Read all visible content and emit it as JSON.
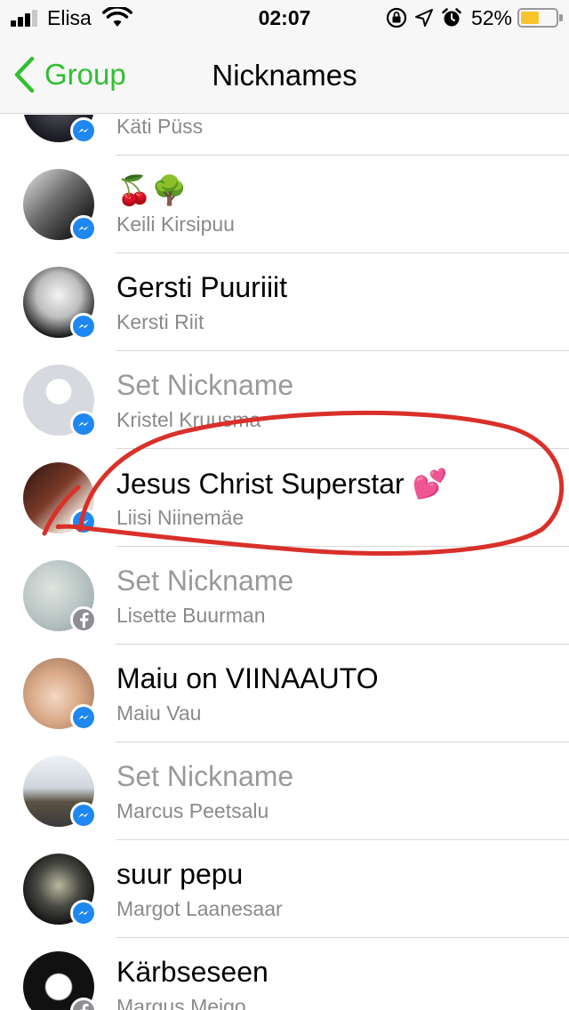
{
  "status_bar": {
    "carrier": "Elisa",
    "time": "02:07",
    "battery_percent": "52%",
    "battery_level": 0.52,
    "battery_color": "#f7c52b",
    "icons": [
      "signal-icon",
      "wifi-icon",
      "orientation-lock-icon",
      "location-arrow-icon",
      "alarm-icon",
      "battery-icon"
    ]
  },
  "nav": {
    "back_label": "Group",
    "title": "Nicknames",
    "accent_color": "#30c030"
  },
  "rows": [
    {
      "nickname": "",
      "name": "Käti Püss",
      "is_placeholder": false,
      "badge": "messenger"
    },
    {
      "nickname": "🍒🌳",
      "name": "Keili Kirsipuu",
      "is_placeholder": false,
      "badge": "messenger"
    },
    {
      "nickname": "Gersti  Puuriiit",
      "name": "Kersti Riit",
      "is_placeholder": false,
      "badge": "messenger"
    },
    {
      "nickname": "Set Nickname",
      "name": "Kristel Kruusma",
      "is_placeholder": true,
      "badge": "messenger"
    },
    {
      "nickname": "Jesus Christ Superstar 💕",
      "name": "Liisi Niinemäe",
      "is_placeholder": false,
      "badge": "messenger"
    },
    {
      "nickname": "Set Nickname",
      "name": "Lisette Buurman",
      "is_placeholder": true,
      "badge": "facebook"
    },
    {
      "nickname": "Maiu on VIINAAUTO",
      "name": "Maiu Vau",
      "is_placeholder": false,
      "badge": "messenger"
    },
    {
      "nickname": "Set Nickname",
      "name": "Marcus Peetsalu",
      "is_placeholder": true,
      "badge": "messenger"
    },
    {
      "nickname": "suur pepu",
      "name": "Margot Laanesaar",
      "is_placeholder": false,
      "badge": "messenger"
    },
    {
      "nickname": "Kärbseseen",
      "name": "Margus Meigo",
      "is_placeholder": false,
      "badge": "facebook"
    }
  ],
  "annotation_color": "#d9302a"
}
